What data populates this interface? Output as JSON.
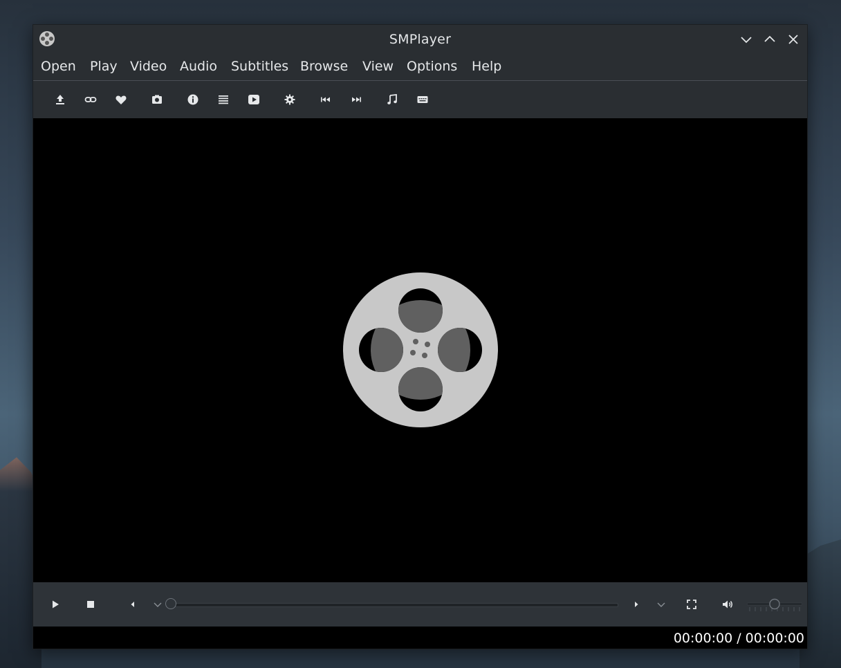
{
  "window": {
    "title": "SMPlayer"
  },
  "menu": [
    "Open",
    "Play",
    "Video",
    "Audio",
    "Subtitles",
    "Browse",
    "View",
    "Options",
    "Help"
  ],
  "toolbar_icons": [
    "open-file-icon",
    "open-url-icon",
    "favorites-icon",
    "screenshot-icon",
    "info-icon",
    "playlist-icon",
    "youtube-icon",
    "preferences-icon",
    "previous-icon",
    "next-icon",
    "audio-track-icon",
    "subtitles-icon"
  ],
  "controls": {
    "seek_position": 0,
    "volume_fraction": 0.5
  },
  "status": {
    "time": "00:00:00 / 00:00:00"
  },
  "colors": {
    "window_bg": "#2a2e32",
    "controls_bg": "#2e3338",
    "video_bg": "#000000",
    "reel_light": "#c8c8c8",
    "reel_dark": "#606060"
  }
}
